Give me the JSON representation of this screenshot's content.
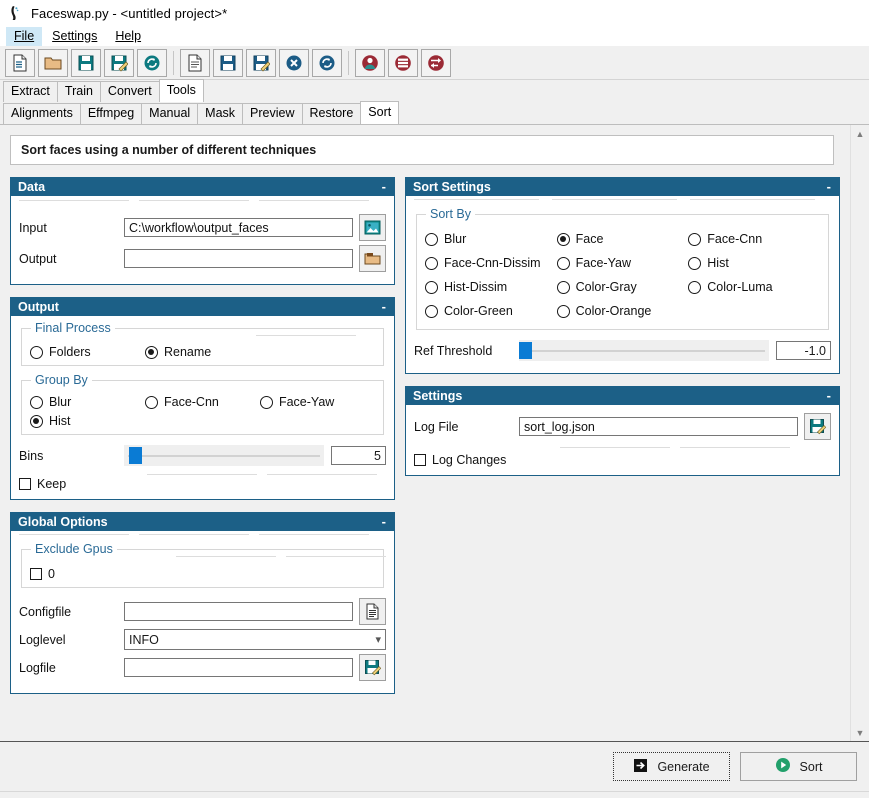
{
  "window": {
    "title": "Faceswap.py - <untitled project>*",
    "icon": "faceswap-logo-icon"
  },
  "menubar": {
    "items": [
      {
        "label": "File",
        "active": true
      },
      {
        "label": "Settings",
        "active": false
      },
      {
        "label": "Help",
        "active": false
      }
    ]
  },
  "toolbar": {
    "buttons": [
      {
        "name": "new-project-icon",
        "tip": "New Project"
      },
      {
        "name": "open-project-icon",
        "tip": "Open Project"
      },
      {
        "name": "save-project-icon",
        "tip": "Save Project"
      },
      {
        "name": "save-project-as-icon",
        "tip": "Save Project As"
      },
      {
        "name": "reload-project-icon",
        "tip": "Reload Project"
      },
      {
        "name": "new-task-icon",
        "tip": "New Task"
      },
      {
        "name": "save-task-icon",
        "tip": "Save Task"
      },
      {
        "name": "save-task-as-icon",
        "tip": "Save Task As"
      },
      {
        "name": "clear-task-icon",
        "tip": "Clear Task"
      },
      {
        "name": "reload-task-icon",
        "tip": "Reload Task"
      },
      {
        "name": "extract-tool-icon",
        "tip": "Extract"
      },
      {
        "name": "train-tool-icon",
        "tip": "Train"
      },
      {
        "name": "convert-tool-icon",
        "tip": "Convert"
      }
    ]
  },
  "tabs_primary": [
    {
      "label": "Extract",
      "selected": false
    },
    {
      "label": "Train",
      "selected": false
    },
    {
      "label": "Convert",
      "selected": false
    },
    {
      "label": "Tools",
      "selected": true
    }
  ],
  "tabs_secondary": [
    {
      "label": "Alignments",
      "selected": false
    },
    {
      "label": "Effmpeg",
      "selected": false
    },
    {
      "label": "Manual",
      "selected": false
    },
    {
      "label": "Mask",
      "selected": false
    },
    {
      "label": "Preview",
      "selected": false
    },
    {
      "label": "Restore",
      "selected": false
    },
    {
      "label": "Sort",
      "selected": true
    }
  ],
  "banner": {
    "text": "Sort faces using a number of different techniques"
  },
  "panels": {
    "data": {
      "title": "Data",
      "collapse": "-",
      "input_label": "Input",
      "input_value": "C:\\workflow\\output_faces",
      "input_browse_icon": "image-browse-icon",
      "output_label": "Output",
      "output_value": "",
      "output_browse_icon": "folder-browse-icon"
    },
    "output": {
      "title": "Output",
      "collapse": "-",
      "final_process_legend": "Final Process",
      "final_process": [
        {
          "label": "Folders",
          "selected": false
        },
        {
          "label": "Rename",
          "selected": true
        }
      ],
      "group_by_legend": "Group By",
      "group_by": [
        {
          "label": "Blur",
          "selected": false
        },
        {
          "label": "Face-Cnn",
          "selected": false
        },
        {
          "label": "Face-Yaw",
          "selected": false
        },
        {
          "label": "Hist",
          "selected": true
        }
      ],
      "bins_label": "Bins",
      "bins_value": "5",
      "bins_thumb_pct": 3,
      "keep_label": "Keep",
      "keep_checked": false
    },
    "global_options": {
      "title": "Global Options",
      "collapse": "-",
      "exclude_gpus_legend": "Exclude Gpus",
      "gpus": [
        {
          "label": "0",
          "checked": false
        }
      ],
      "configfile_label": "Configfile",
      "configfile_value": "",
      "configfile_icon": "file-browse-icon",
      "loglevel_label": "Loglevel",
      "loglevel_value": "INFO",
      "loglevel_caret": "chevron-down-icon",
      "logfile_label": "Logfile",
      "logfile_value": "",
      "logfile_icon": "save-file-icon"
    },
    "sort_settings": {
      "title": "Sort Settings",
      "collapse": "-",
      "sort_by_legend": "Sort By",
      "sort_by": [
        {
          "label": "Blur",
          "selected": false
        },
        {
          "label": "Face",
          "selected": true
        },
        {
          "label": "Face-Cnn",
          "selected": false
        },
        {
          "label": "Face-Cnn-Dissim",
          "selected": false
        },
        {
          "label": "Face-Yaw",
          "selected": false
        },
        {
          "label": "Hist",
          "selected": false
        },
        {
          "label": "Hist-Dissim",
          "selected": false
        },
        {
          "label": "Color-Gray",
          "selected": false
        },
        {
          "label": "Color-Luma",
          "selected": false
        },
        {
          "label": "Color-Green",
          "selected": false
        },
        {
          "label": "Color-Orange",
          "selected": false
        }
      ],
      "ref_threshold_label": "Ref Threshold",
      "ref_threshold_value": "-1.0",
      "ref_threshold_thumb_pct": 0
    },
    "settings": {
      "title": "Settings",
      "collapse": "-",
      "log_file_label": "Log File",
      "log_file_value": "sort_log.json",
      "log_file_icon": "save-file-icon",
      "log_changes_label": "Log Changes",
      "log_changes_checked": false
    }
  },
  "footer": {
    "generate_label": "Generate",
    "generate_icon": "arrow-into-box-icon",
    "sort_label": "Sort",
    "sort_icon": "play-circle-icon"
  },
  "colors": {
    "panel_header": "#1c6087",
    "legend_text": "#2a6a96",
    "slider_thumb": "#0a7bd4",
    "sort_button_accent": "#22a06b",
    "window_bg": "#f0f0f0"
  }
}
